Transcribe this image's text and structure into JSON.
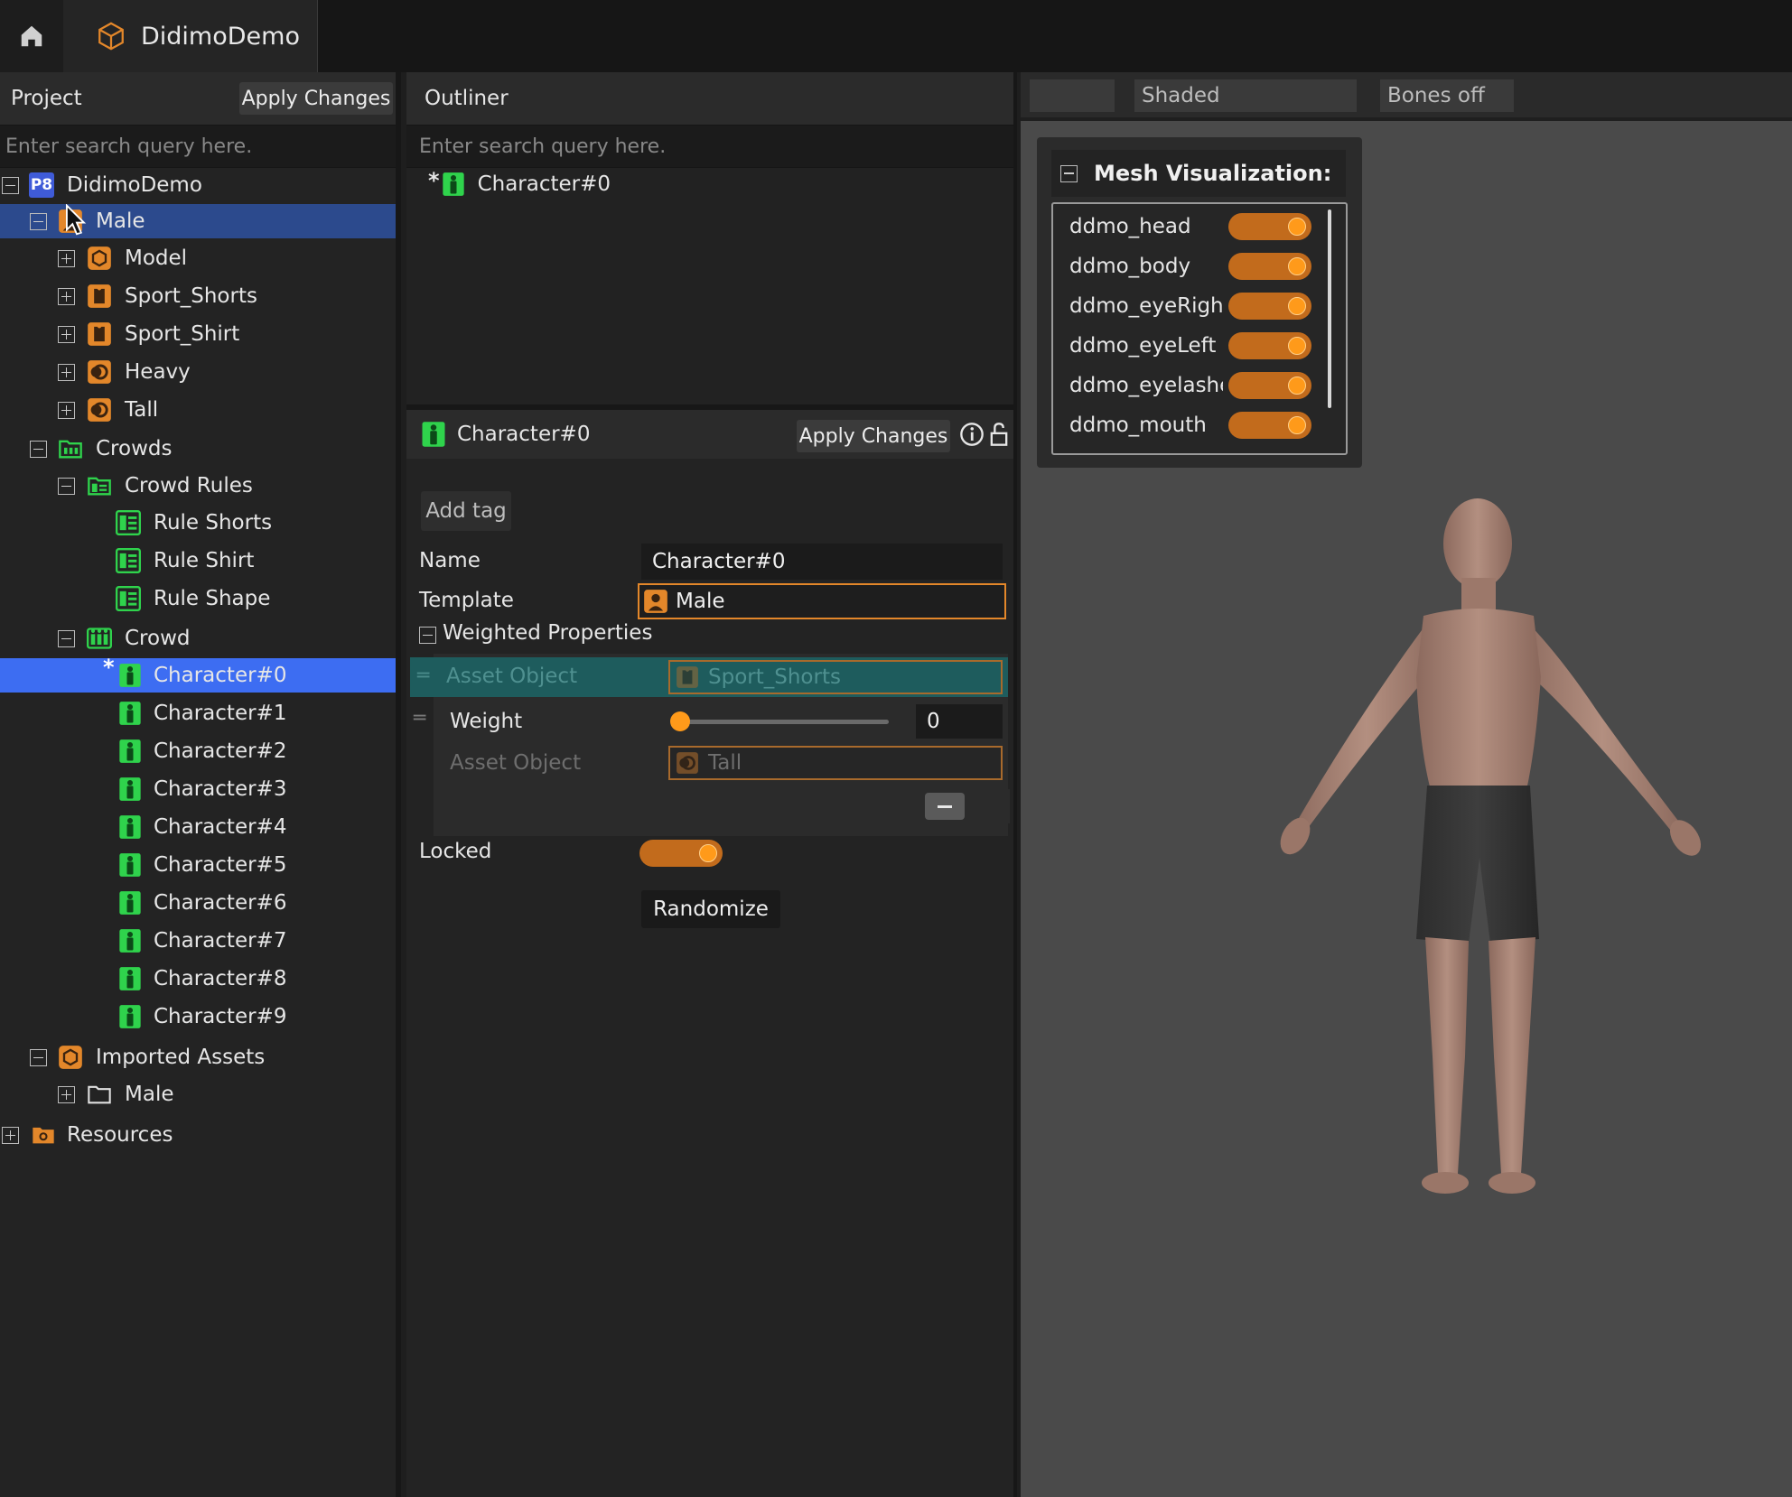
{
  "app": {
    "tab_title": "DidimoDemo"
  },
  "project": {
    "title": "Project",
    "apply_label": "Apply Changes",
    "search_placeholder": "Enter search query here.",
    "tree": {
      "root": "DidimoDemo",
      "root_badge": "P8",
      "male": "Male",
      "model": "Model",
      "sport_shorts": "Sport_Shorts",
      "sport_shirt": "Sport_Shirt",
      "heavy": "Heavy",
      "tall": "Tall",
      "crowds": "Crowds",
      "crowd_rules": "Crowd Rules",
      "rule_shorts": "Rule Shorts",
      "rule_shirt": "Rule Shirt",
      "rule_shape": "Rule Shape",
      "crowd": "Crowd",
      "characters": [
        "Character#0",
        "Character#1",
        "Character#2",
        "Character#3",
        "Character#4",
        "Character#5",
        "Character#6",
        "Character#7",
        "Character#8",
        "Character#9"
      ],
      "imported_assets": "Imported Assets",
      "imported_male": "Male",
      "resources": "Resources"
    }
  },
  "outliner": {
    "title": "Outliner",
    "search_placeholder": "Enter search query here.",
    "item": "Character#0"
  },
  "properties": {
    "title": "Character#0",
    "apply_label": "Apply Changes",
    "add_tag": "Add tag",
    "name_label": "Name",
    "name_value": "Character#0",
    "template_label": "Template",
    "template_value": "Male",
    "weighted_label": "Weighted Properties",
    "asset_object_label": "Asset Object",
    "asset1_value": "Sport_Shorts",
    "weight_label": "Weight",
    "weight_value": "0",
    "asset2_value": "Tall",
    "locked_label": "Locked",
    "randomize_label": "Randomize"
  },
  "viewport": {
    "mode_blank": "",
    "shading": "Shaded",
    "bones": "Bones off",
    "mesh_title": "Mesh Visualization:",
    "mesh_items": [
      "ddmo_head",
      "ddmo_body",
      "ddmo_eyeRight",
      "ddmo_eyeLeft",
      "ddmo_eyelashes",
      "ddmo_mouth"
    ]
  },
  "colors": {
    "accent_orange": "#e3872a",
    "character_green": "#2fd34c",
    "selection_blue": "#3d6df2",
    "selection_dark_blue": "#2c4a8d"
  }
}
